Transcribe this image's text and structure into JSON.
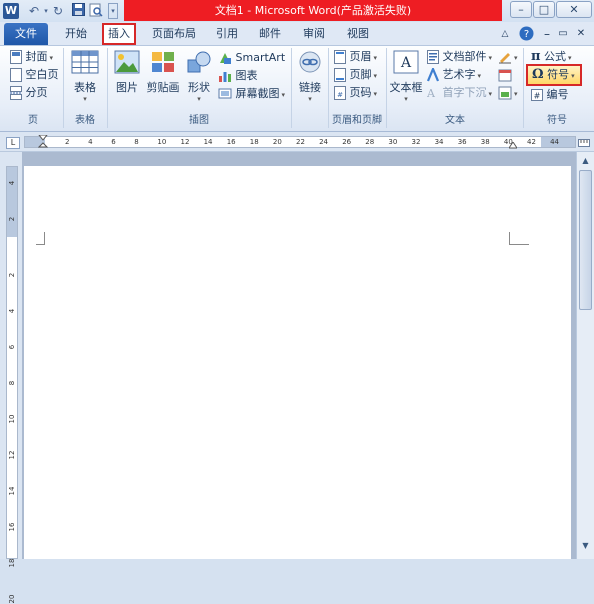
{
  "window": {
    "title": "文档1 - Microsoft Word(产品激活失败)",
    "app_icon": "W",
    "controls": {
      "minimize": "–",
      "restore": "□",
      "close": "✕"
    }
  },
  "tabs": [
    "开始",
    "插入",
    "页面布局",
    "引用",
    "邮件",
    "审阅",
    "视图"
  ],
  "file_tab": "文件",
  "active_tab": "插入",
  "ribbon": {
    "pages": {
      "label": "页",
      "cover": "封面",
      "blank": "空白页",
      "break": "分页"
    },
    "tables": {
      "label": "表格",
      "table": "表格"
    },
    "illustrations": {
      "label": "插图",
      "picture": "图片",
      "clipart": "剪贴画",
      "shapes": "形状",
      "smartart": "SmartArt",
      "chart": "图表",
      "screenshot": "屏幕截图"
    },
    "links": {
      "label": "链接"
    },
    "header_footer": {
      "label": "页眉和页脚",
      "header": "页眉",
      "footer": "页脚",
      "page_number": "页码"
    },
    "text": {
      "label": "文本",
      "textbox": "文本框",
      "quickparts": "文档部件",
      "wordart": "艺术字",
      "dropcap": "首字下沉"
    },
    "symbols": {
      "label": "符号",
      "equation": "公式",
      "symbol": "符号",
      "number": "编号"
    }
  },
  "ruler": {
    "h_marks": [
      "2",
      "4",
      "6",
      "8",
      "10",
      "12",
      "14",
      "16",
      "18",
      "20",
      "22",
      "24",
      "26",
      "28",
      "30",
      "32",
      "34",
      "36",
      "38",
      "40",
      "42",
      "44"
    ],
    "v_marks": [
      "4",
      "2",
      "2",
      "4",
      "6",
      "8",
      "10",
      "12",
      "14",
      "16",
      "18",
      "20"
    ],
    "tab_selector": "L"
  },
  "colors": {
    "accent_red": "#ee1d23",
    "highlight_border": "#d62828",
    "file_tab": "#2b5797"
  }
}
